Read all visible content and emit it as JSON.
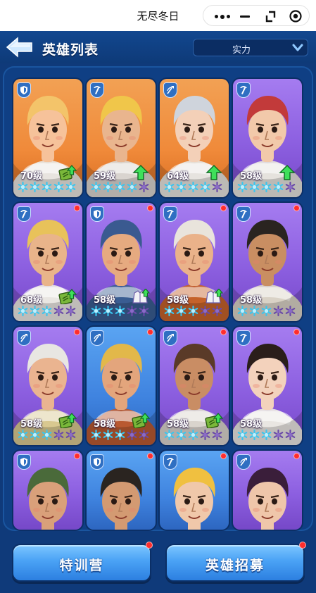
{
  "window": {
    "title": "无尽冬日"
  },
  "header": {
    "title": "英雄列表",
    "sort_label": "实力"
  },
  "heroes": [
    {
      "level": "70级",
      "bg": "orange",
      "cls": "shield",
      "stars": 5,
      "filled": 5,
      "upgrade": "scroll",
      "dot": false,
      "skin": "#f6c29a",
      "hair": "#f3c46a",
      "outfit": "#e8e4de"
    },
    {
      "level": "59级",
      "bg": "orange",
      "cls": "pick",
      "stars": 5,
      "filled": 4,
      "upgrade": "arrow",
      "dot": false,
      "skin": "#e9b58e",
      "hair": "#f0c64a",
      "outfit": "#d9d4cf"
    },
    {
      "level": "64级",
      "bg": "orange",
      "cls": "bow",
      "stars": 5,
      "filled": 4,
      "upgrade": "arrow",
      "dot": false,
      "skin": "#f3d0b8",
      "hair": "#cfd4dc",
      "outfit": "#e6e3de"
    },
    {
      "level": "58级",
      "bg": "purple",
      "cls": "pick",
      "stars": 5,
      "filled": 4,
      "upgrade": "arrow",
      "dot": false,
      "skin": "#f2c9aa",
      "hair": "#c23a3a",
      "outfit": "#e5e1dc"
    },
    {
      "level": "68级",
      "bg": "purple",
      "cls": "pick",
      "stars": 5,
      "filled": 3,
      "upgrade": "scroll",
      "dot": true,
      "skin": "#e9b48a",
      "hair": "#e8c25a",
      "outfit": "#e9e6e2"
    },
    {
      "level": "58级",
      "bg": "purple",
      "cls": "shield",
      "stars": 5,
      "filled": 3,
      "upgrade": "coat",
      "dot": true,
      "skin": "#e6aa80",
      "hair": "#3a5a90",
      "outfit": "#3a5d92"
    },
    {
      "level": "58级",
      "bg": "purple",
      "cls": "pick",
      "stars": 5,
      "filled": 3,
      "upgrade": "coat",
      "dot": true,
      "skin": "#eab28a",
      "hair": "#e9e4dc",
      "outfit": "#c5622a"
    },
    {
      "level": "58级",
      "bg": "purple",
      "cls": "pick",
      "stars": 5,
      "filled": 3,
      "upgrade": "none",
      "dot": true,
      "skin": "#c98e62",
      "hair": "#2a2420",
      "outfit": "#d9d2c6"
    },
    {
      "level": "58级",
      "bg": "purple",
      "cls": "bow",
      "stars": 5,
      "filled": 3,
      "upgrade": "scroll",
      "dot": true,
      "skin": "#eab490",
      "hair": "#e8e6e2",
      "outfit": "#d8c890"
    },
    {
      "level": "58级",
      "bg": "blue",
      "cls": "bow",
      "stars": 5,
      "filled": 3,
      "upgrade": "scroll",
      "dot": true,
      "skin": "#e3a57c",
      "hair": "#e2b84a",
      "outfit": "#b85a32"
    },
    {
      "level": "58级",
      "bg": "purple",
      "cls": "bow",
      "stars": 5,
      "filled": 3,
      "upgrade": "scroll",
      "dot": true,
      "skin": "#c98d64",
      "hair": "#5a3a28",
      "outfit": "#d9d4cc"
    },
    {
      "level": "58级",
      "bg": "purple",
      "cls": "pick",
      "stars": 5,
      "filled": 3,
      "upgrade": "none",
      "dot": true,
      "skin": "#f3d2bc",
      "hair": "#2a1e1a",
      "outfit": "#e9e6e2"
    },
    {
      "level": "",
      "bg": "purple",
      "cls": "shield",
      "stars": 0,
      "filled": 0,
      "upgrade": "none",
      "dot": true,
      "skin": "#d9a07a",
      "hair": "#4a6a3a",
      "outfit": "#e6e2dc"
    },
    {
      "level": "",
      "bg": "blue",
      "cls": "shield",
      "stars": 0,
      "filled": 0,
      "upgrade": "none",
      "dot": true,
      "skin": "#d39a72",
      "hair": "#2a2420",
      "outfit": "#7a4a2a"
    },
    {
      "level": "",
      "bg": "blue",
      "cls": "pick",
      "stars": 0,
      "filled": 0,
      "upgrade": "none",
      "dot": true,
      "skin": "#f0c8aa",
      "hair": "#f0c040",
      "outfit": "#e0dcd6"
    },
    {
      "level": "",
      "bg": "purple",
      "cls": "bow",
      "stars": 0,
      "filled": 0,
      "upgrade": "none",
      "dot": true,
      "skin": "#efc6aa",
      "hair": "#3a1e3a",
      "outfit": "#5a2a5a"
    }
  ],
  "buttons": {
    "training": "特训营",
    "recruit": "英雄招募"
  },
  "colors": {
    "star_filled": "#39c6f0",
    "star_empty": "#6a4aa8",
    "badge": "#2f6fc2",
    "notify": "#ff2d2d"
  }
}
